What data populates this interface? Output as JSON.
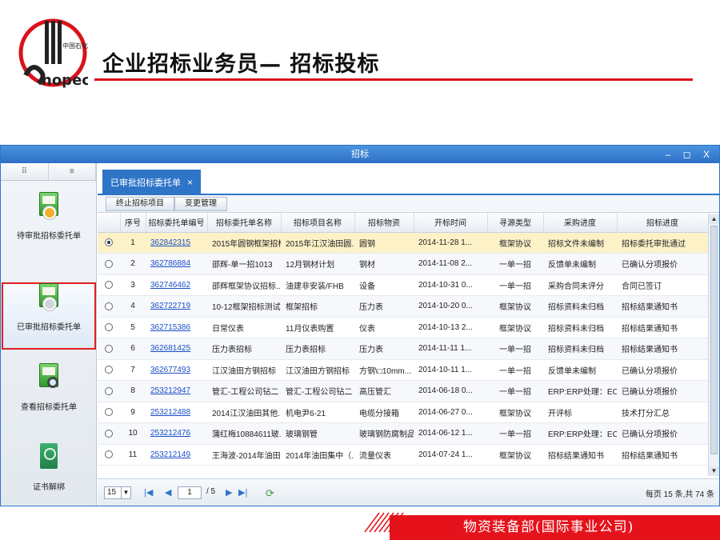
{
  "slide": {
    "logo_text": "Sinopec",
    "title": "企业招标业务员— 招标投标",
    "footer": "物资装备部(国际事业公司)"
  },
  "window": {
    "title": "招标",
    "controls": "– ◻ X"
  },
  "nav": {
    "tab_icons": [
      "grid-icon",
      "list-icon"
    ],
    "items": [
      {
        "label": "待审批招标委托单",
        "icon": "book-badge-icon"
      },
      {
        "label": "已审批招标委托单",
        "icon": "book-badge-icon",
        "selected": true
      },
      {
        "label": "查看招标委托单",
        "icon": "book-search-icon"
      },
      {
        "label": "证书解绑",
        "icon": "certificate-icon"
      }
    ]
  },
  "tab": {
    "label": "已审批招标委托单",
    "close": "×"
  },
  "toolbar": {
    "btn_terminate": "终止招标项目",
    "btn_change": "变更管理"
  },
  "table": {
    "headers": [
      "",
      "序号",
      "招标委托单编号",
      "招标委托单名称",
      "招标项目名称",
      "招标物资",
      "开标时间",
      "寻源类型",
      "采购进度",
      "招标进度"
    ],
    "rows": [
      {
        "selected": true,
        "no": "1",
        "code": "362842315",
        "name": "2015年圆钢框架招标",
        "project": "2015年江汉油田圆...",
        "material": "圆钢",
        "time": "2014-11-28 1...",
        "type": "框架协议",
        "purchase": "招标文件未编制",
        "bid": "招标委托审批通过"
      },
      {
        "selected": false,
        "no": "2",
        "code": "362786884",
        "name": "邵辉-单一招1013",
        "project": "12月钢材计划",
        "material": "钢材",
        "time": "2014-11-08 2...",
        "type": "一单一招",
        "purchase": "反馈单未编制",
        "bid": "已确认分项报价"
      },
      {
        "selected": false,
        "no": "3",
        "code": "362746462",
        "name": "邵辉框架协议招标...",
        "project": "油建非安装/FHB",
        "material": "设备",
        "time": "2014-10-31 0...",
        "type": "一单一招",
        "purchase": "采购合同未评分",
        "bid": "合同已签订"
      },
      {
        "selected": false,
        "no": "4",
        "code": "362722719",
        "name": "10-12框架招标测试",
        "project": "框架招标",
        "material": "压力表",
        "time": "2014-10-20 0...",
        "type": "框架协议",
        "purchase": "招标资料未归档",
        "bid": "招标结果通知书"
      },
      {
        "selected": false,
        "no": "5",
        "code": "362715386",
        "name": "日常仪表",
        "project": "11月仪表购置",
        "material": "仪表",
        "time": "2014-10-13 2...",
        "type": "框架协议",
        "purchase": "招标资料未归档",
        "bid": "招标结果通知书"
      },
      {
        "selected": false,
        "no": "6",
        "code": "362681425",
        "name": "压力表招标",
        "project": "压力表招标",
        "material": "压力表",
        "time": "2014-11-11 1...",
        "type": "一单一招",
        "purchase": "招标资料未归档",
        "bid": "招标结果通知书"
      },
      {
        "selected": false,
        "no": "7",
        "code": "362677493",
        "name": "江汉油田方钢招标",
        "project": "江汉油田方钢招标",
        "material": "方钢\\□10mm...",
        "time": "2014-10-11 1...",
        "type": "一单一招",
        "purchase": "反馈单未编制",
        "bid": "已确认分项报价"
      },
      {
        "selected": false,
        "no": "8",
        "code": "253212947",
        "name": "管汇-工程公司钻二",
        "project": "管汇-工程公司钻二",
        "material": "高压管汇",
        "time": "2014-06-18 0...",
        "type": "一单一招",
        "purchase": "ERP:ERP处理：EC...",
        "bid": "已确认分项报价"
      },
      {
        "selected": false,
        "no": "9",
        "code": "253212488",
        "name": "2014江汉油田其他...",
        "project": "机电尹6-21",
        "material": "电缆分接箱",
        "time": "2014-06-27 0...",
        "type": "框架协议",
        "purchase": "开评标",
        "bid": "技术打分汇总"
      },
      {
        "selected": false,
        "no": "10",
        "code": "253212476",
        "name": "蒲红梅10884611玻...",
        "project": "玻璃钢管",
        "material": "玻璃钢防腐制品",
        "time": "2014-06-12 1...",
        "type": "一单一招",
        "purchase": "ERP:ERP处理：EC...",
        "bid": "已确认分项报价"
      },
      {
        "selected": false,
        "no": "11",
        "code": "253212149",
        "name": "王海波-2014年油田...",
        "project": "2014年油田集中（...",
        "material": "流量仪表",
        "time": "2014-07-24 1...",
        "type": "框架协议",
        "purchase": "招标结果通知书",
        "bid": "招标结果通知书"
      }
    ]
  },
  "pager": {
    "page_size": "15",
    "current_page": "1",
    "total_pages": "/ 5",
    "summary": "每页 15 条,共 74 条"
  }
}
